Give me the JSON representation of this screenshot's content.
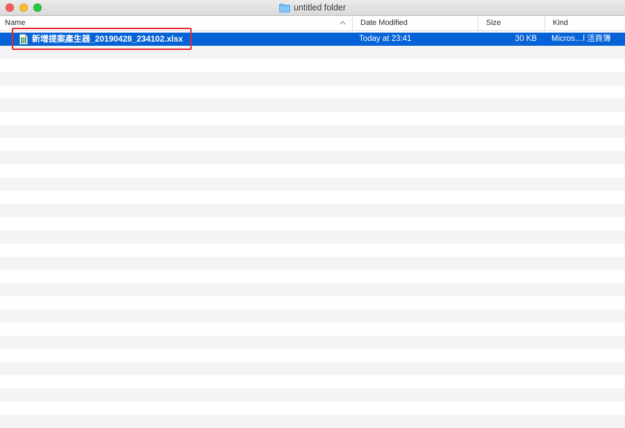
{
  "window": {
    "title": "untitled folder",
    "folder_icon": "folder-icon"
  },
  "columns": {
    "name": "Name",
    "date": "Date Modified",
    "size": "Size",
    "kind": "Kind",
    "sort_indicator": "^"
  },
  "files": [
    {
      "name": "新增提案產生器_20190428_234102.xlsx",
      "date": "Today at 23:41",
      "size": "30 KB",
      "kind": "Micros…l 活頁簿",
      "icon": "spreadsheet-file-icon",
      "selected": true
    }
  ],
  "colors": {
    "selection": "#0663d7",
    "annotation_box": "#e5262b",
    "stripe": "#f4f4f6"
  }
}
